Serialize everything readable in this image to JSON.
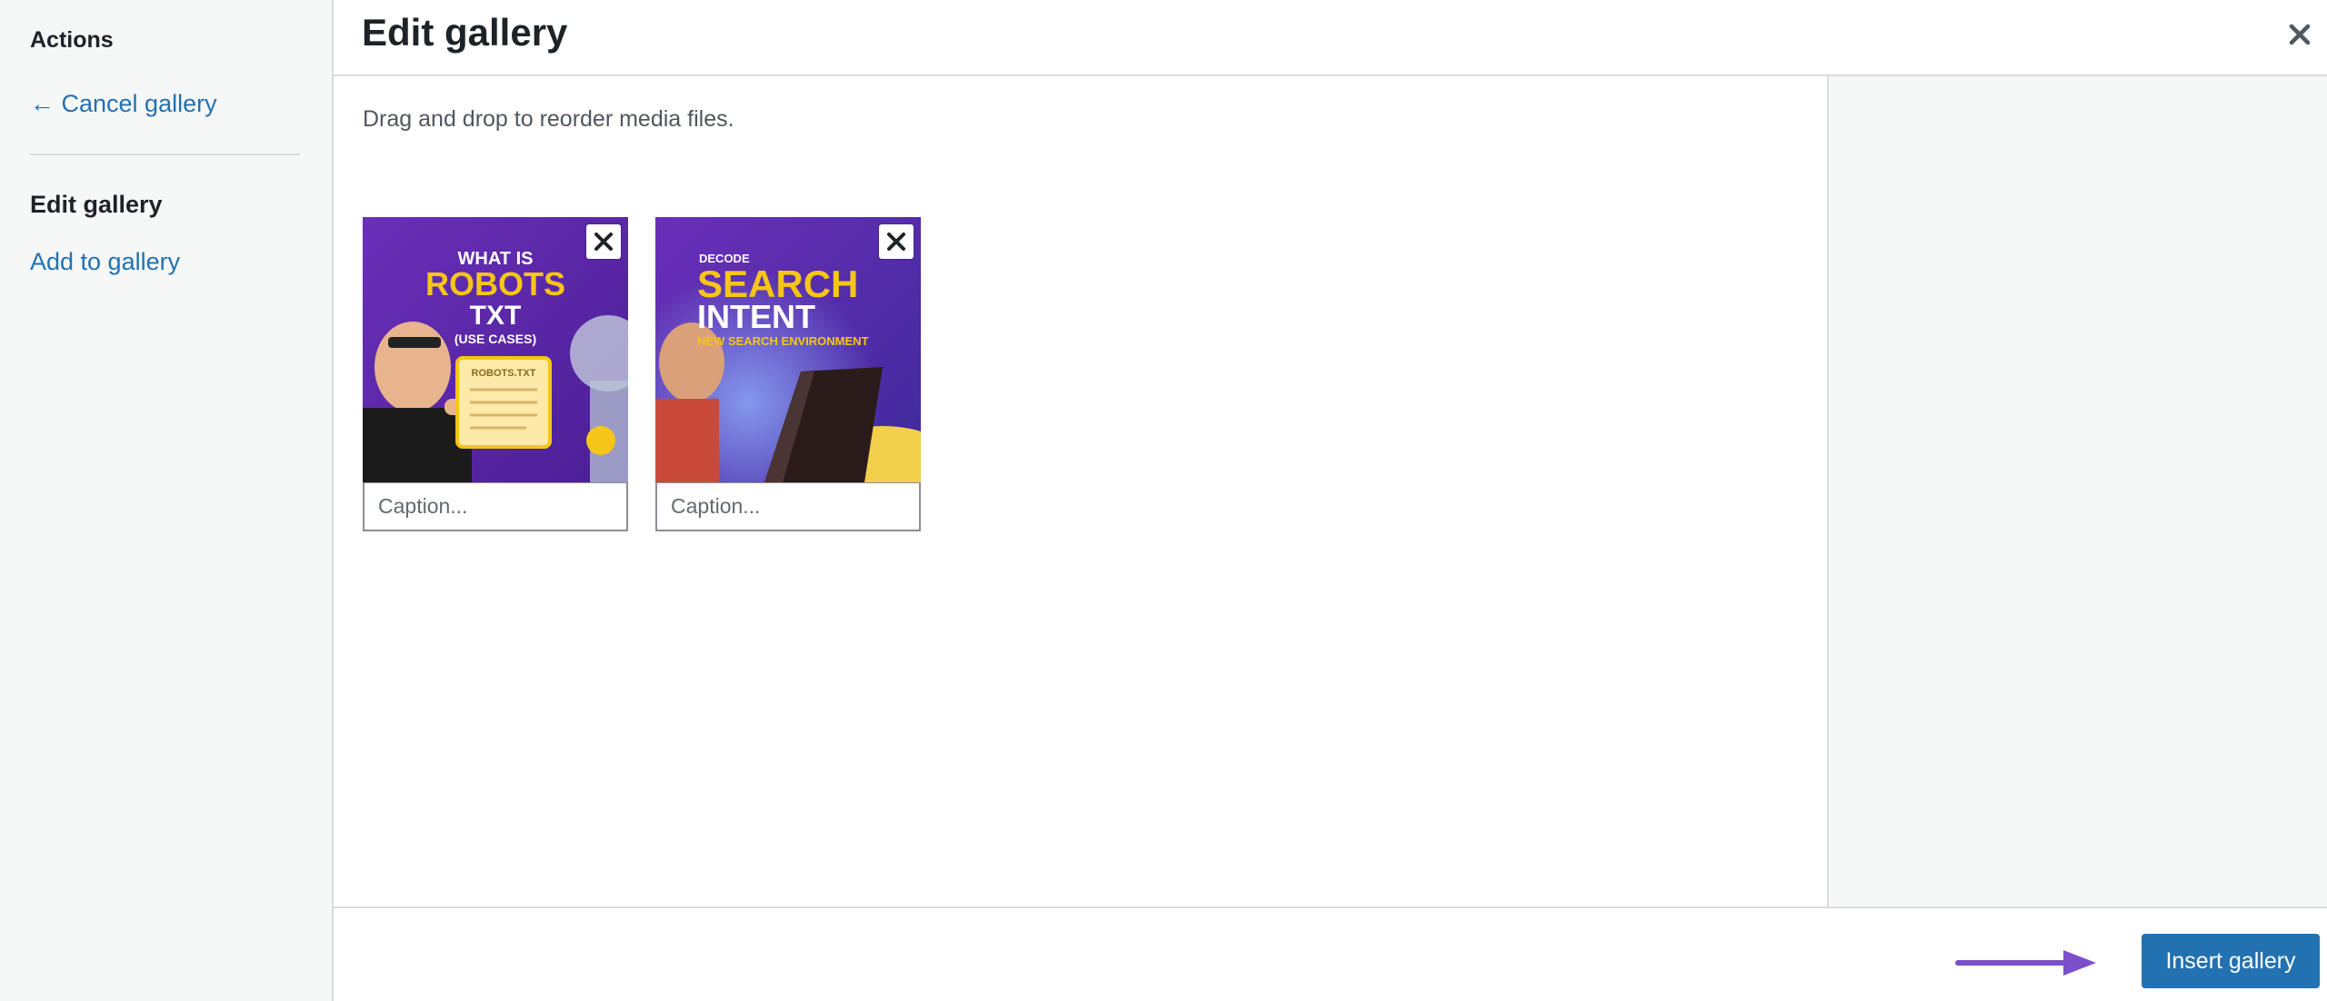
{
  "sidebar": {
    "heading": "Actions",
    "cancel_label": "← Cancel gallery",
    "active_item": "Edit gallery",
    "add_label": "Add to gallery"
  },
  "header": {
    "title": "Edit gallery",
    "close_icon": "close-icon"
  },
  "main": {
    "instruction": "Drag and drop to reorder media files.",
    "items": [
      {
        "thumb_lines": [
          "WHAT IS",
          "ROBOTS",
          "TXT",
          "(USE CASES)"
        ],
        "card_label": "ROBOTS.TXT",
        "caption_placeholder": "Caption..."
      },
      {
        "thumb_lines": [
          "DECODE",
          "SEARCH",
          "INTENT",
          "NEW SEARCH ENVIRONMENT"
        ],
        "caption_placeholder": "Caption..."
      }
    ]
  },
  "toolbar": {
    "insert_label": "Insert gallery",
    "annotation_color": "#7b4fc9"
  },
  "colors": {
    "accent": "#2271b1",
    "thumb_bg": "#5b2fa8",
    "thumb_text": "#f5c518"
  }
}
